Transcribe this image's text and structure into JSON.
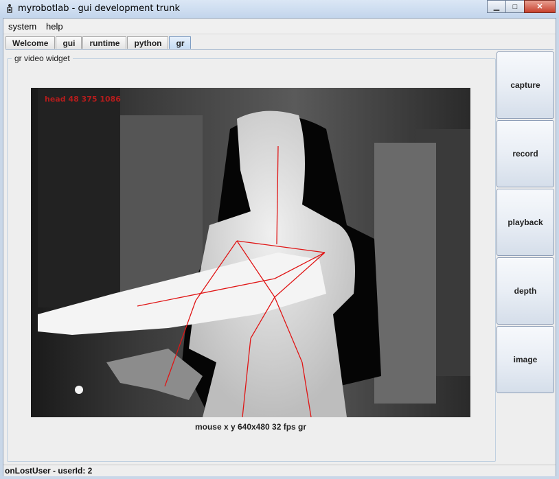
{
  "window": {
    "title": "myrobotlab - gui development trunk",
    "controls": {
      "minimize": "▁",
      "maximize": "□",
      "close": "✕"
    }
  },
  "menu": {
    "items": [
      "system",
      "help"
    ]
  },
  "tabs": {
    "items": [
      "Welcome",
      "gui",
      "runtime",
      "python",
      "gr"
    ],
    "active": "gr"
  },
  "panel": {
    "title": "gr  video widget"
  },
  "video": {
    "overlay_text": "head 48 375 1086",
    "caption": "mouse x y  640x480  32 fps  gr"
  },
  "side_buttons": {
    "capture": "capture",
    "record": "record",
    "playback": "playback",
    "depth": "depth",
    "image": "image"
  },
  "status": {
    "text": "onLostUser - userId: 2"
  },
  "colors": {
    "skeleton": "#e01515",
    "overlay_text": "#b31c1c",
    "active_tab": "#c6dbf2"
  }
}
